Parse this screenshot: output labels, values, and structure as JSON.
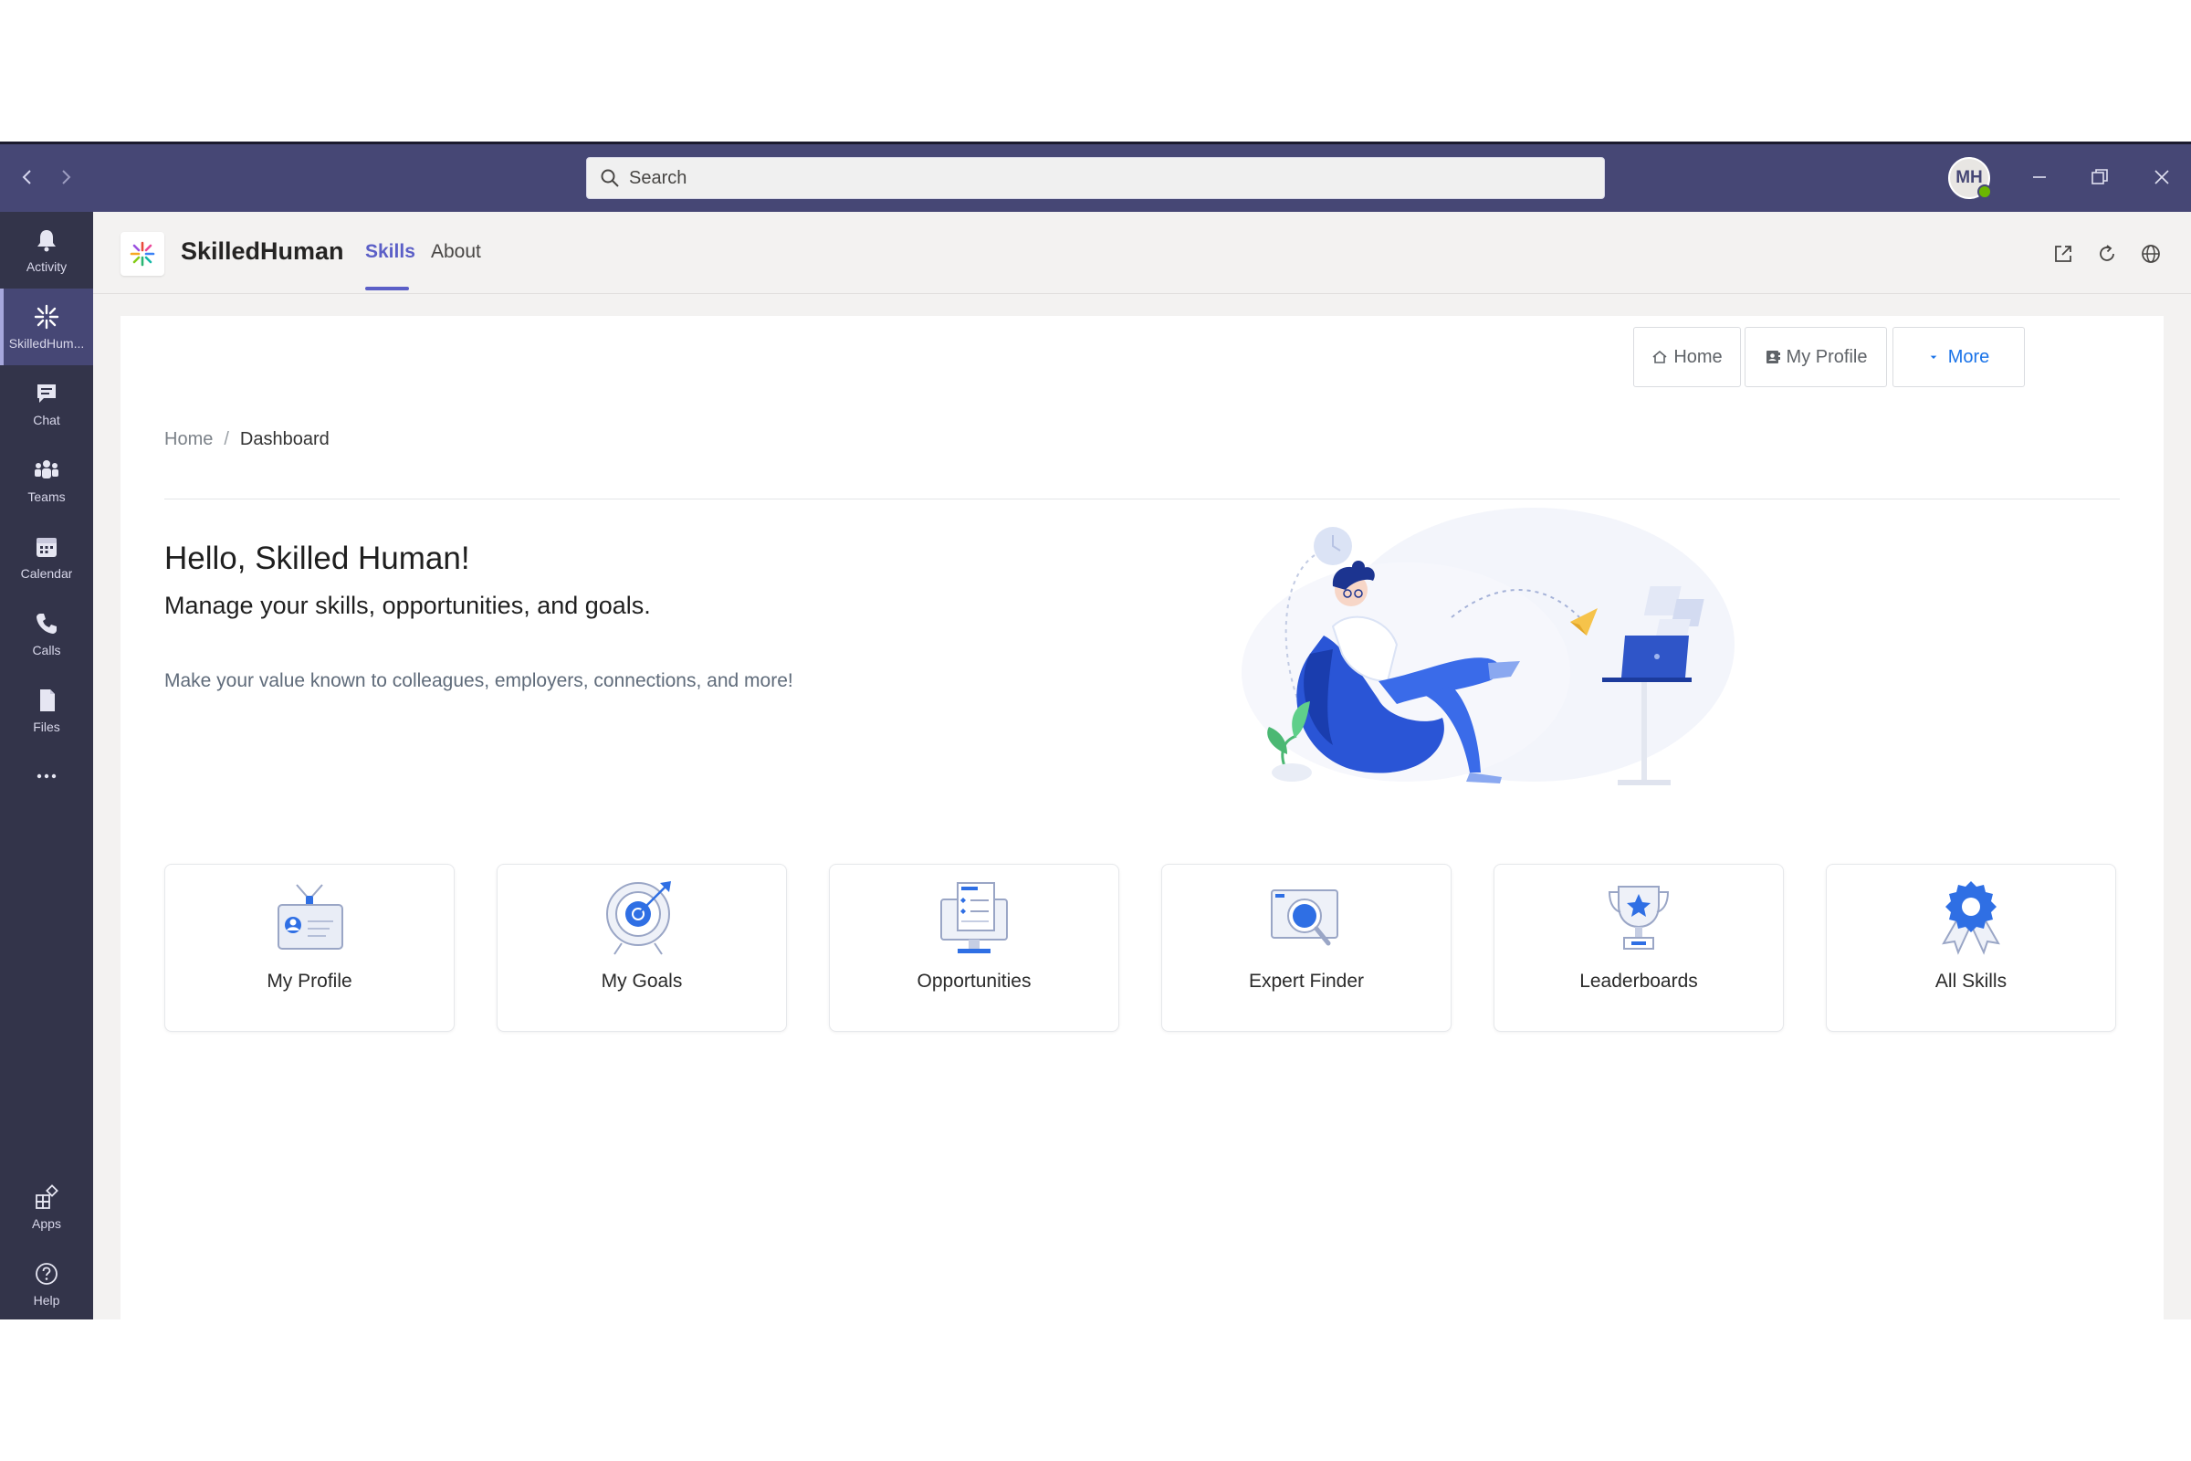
{
  "search": {
    "placeholder": "Search"
  },
  "user": {
    "initials": "MH"
  },
  "rail": [
    {
      "label": "Activity",
      "icon": "bell-icon"
    },
    {
      "label": "SkilledHum...",
      "icon": "skilledhuman-app-icon",
      "active": true
    },
    {
      "label": "Chat",
      "icon": "chat-icon"
    },
    {
      "label": "Teams",
      "icon": "teams-icon"
    },
    {
      "label": "Calendar",
      "icon": "calendar-icon"
    },
    {
      "label": "Calls",
      "icon": "phone-icon"
    },
    {
      "label": "Files",
      "icon": "file-icon"
    }
  ],
  "rail_bottom": [
    {
      "label": "Apps",
      "icon": "apps-icon"
    },
    {
      "label": "Help",
      "icon": "help-icon"
    }
  ],
  "app": {
    "name": "SkilledHuman",
    "tabs": [
      {
        "label": "Skills",
        "active": true
      },
      {
        "label": "About",
        "active": false
      }
    ]
  },
  "toolbar": {
    "home": "Home",
    "profile": "My Profile",
    "more": "More"
  },
  "breadcrumb": {
    "home": "Home",
    "separator": "/",
    "current": "Dashboard"
  },
  "hero": {
    "greeting": "Hello, Skilled Human!",
    "subtitle": "Manage your skills, opportunities, and goals.",
    "tagline": "Make your value known to colleagues, employers, connections, and more!"
  },
  "cards": [
    {
      "label": "My Profile",
      "icon": "profile-badge-icon"
    },
    {
      "label": "My Goals",
      "icon": "target-icon"
    },
    {
      "label": "Opportunities",
      "icon": "monitor-document-icon"
    },
    {
      "label": "Expert Finder",
      "icon": "magnifier-icon"
    },
    {
      "label": "Leaderboards",
      "icon": "trophy-icon"
    },
    {
      "label": "All Skills",
      "icon": "award-ribbon-icon"
    }
  ],
  "colors": {
    "titlebar": "#464775",
    "rail": "#33344a",
    "accent": "#5b5fc7",
    "link": "#1a73e8",
    "icon_blue": "#2f6fe4"
  }
}
